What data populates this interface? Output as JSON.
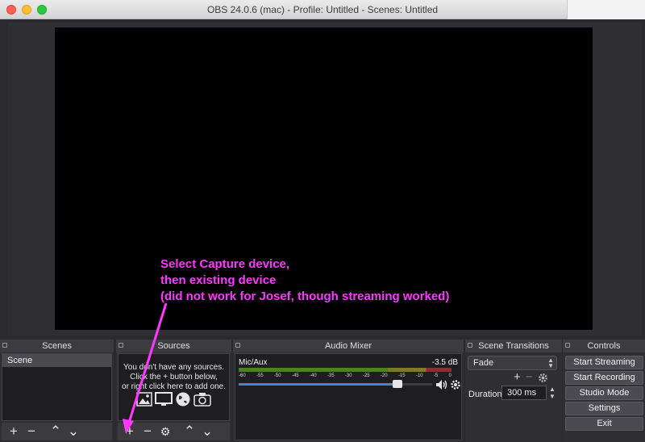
{
  "window": {
    "title": "OBS 24.0.6 (mac) - Profile: Untitled - Scenes: Untitled"
  },
  "annotation": {
    "lines": [
      "Select Capture device,",
      "then existing device",
      "(did not work for Josef, though streaming worked)"
    ],
    "color": "#ff37ff"
  },
  "docks": {
    "scenes": {
      "title": "Scenes",
      "items": [
        "Scene"
      ],
      "toolbar": {
        "add": "+",
        "remove": "−",
        "up": "⌃",
        "down": "⌄"
      }
    },
    "sources": {
      "title": "Sources",
      "empty_message": [
        "You don't have any sources.",
        "Click the + button below,",
        "or right click here to add one."
      ],
      "icons": [
        "image-icon",
        "display-icon",
        "globe-icon",
        "camera-icon"
      ],
      "toolbar": {
        "add": "+",
        "remove": "−",
        "settings": "⚙",
        "up": "⌃",
        "down": "⌄"
      }
    },
    "audio_mixer": {
      "title": "Audio Mixer",
      "channel_name": "Mic/Aux",
      "level_db": "-3.5 dB",
      "ticks": [
        "-60",
        "-55",
        "-50",
        "-45",
        "-40",
        "-35",
        "-30",
        "-25",
        "-20",
        "-15",
        "-10",
        "-5",
        "0"
      ],
      "volume_fraction": 0.82
    },
    "scene_transitions": {
      "title": "Scene Transitions",
      "selected": "Fade",
      "add": "+",
      "remove": "−",
      "duration_label": "Duration",
      "duration_value": "300 ms"
    },
    "controls": {
      "title": "Controls",
      "buttons": [
        "Start Streaming",
        "Start Recording",
        "Studio Mode",
        "Settings",
        "Exit"
      ]
    }
  },
  "colors": {
    "accent": "#3d86d9",
    "annotation": "#ff37ff"
  }
}
